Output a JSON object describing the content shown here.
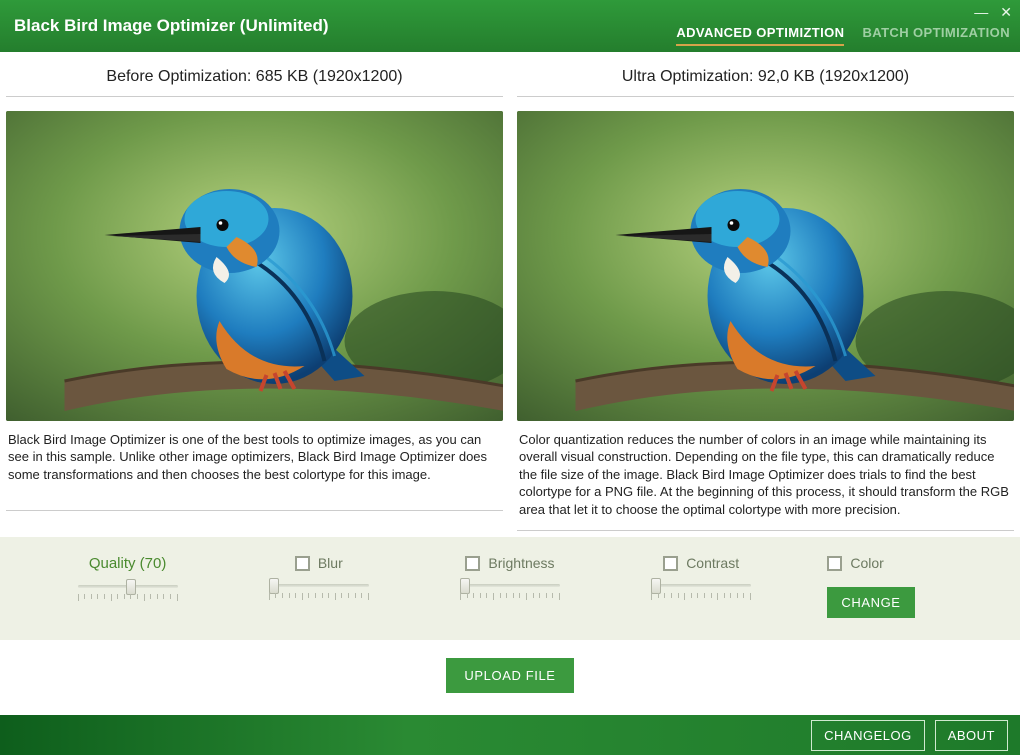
{
  "window": {
    "title": "Black Bird Image Optimizer (Unlimited)"
  },
  "tabs": {
    "advanced": "ADVANCED OPTIMIZTION",
    "batch": "BATCH OPTIMIZATION"
  },
  "before": {
    "title": "Before Optimization: 685 KB (1920x1200)",
    "desc": "Black Bird Image Optimizer is one of the best tools to optimize images, as you can see in this sample. Unlike other image optimizers, Black Bird Image Optimizer does some transformations and then chooses the best colortype for this image."
  },
  "after": {
    "title": "Ultra Optimization: 92,0 KB (1920x1200)",
    "desc": "Color quantization reduces the number of colors in an image while maintaining its overall visual construction. Depending on the file type, this can dramatically reduce the file size of the image. Black Bird Image Optimizer does trials to find the best colortype for a PNG file. At the beginning of this process, it should transform the RGB area that let it to choose the optimal colortype with more precision."
  },
  "controls": {
    "quality_label": "Quality (70)",
    "quality_value": 70,
    "blur": "Blur",
    "brightness": "Brightness",
    "contrast": "Contrast",
    "color": "Color",
    "change": "CHANGE"
  },
  "upload": {
    "label": "UPLOAD FILE"
  },
  "footer": {
    "changelog": "CHANGELOG",
    "about": "ABOUT"
  }
}
